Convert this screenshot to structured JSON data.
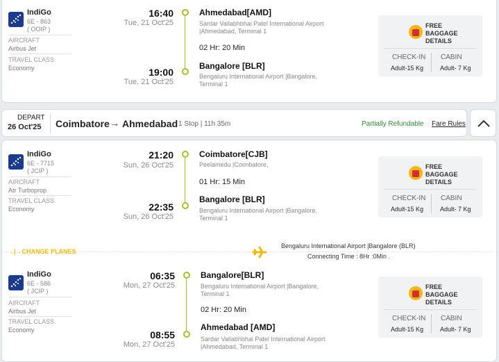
{
  "baggage": {
    "title_line1": "FREE",
    "title_line2": "BAGGAGE",
    "title_line3": "DETAILS",
    "checkin_label": "CHECK-IN",
    "cabin_label": "CABIN",
    "checkin_value": "Adult-15 Kg",
    "cabin_value": "Adult- 7 Kg"
  },
  "labels": {
    "aircraft": "AIRCRAFT",
    "travel_class": "TRAVEL CLASS"
  },
  "flight1": {
    "airline": "IndiGo",
    "flight_no": "6E - 863",
    "code": "( OOIP )",
    "aircraft": "Airbus Jet",
    "class": "Economy",
    "dep_time": "16:40",
    "dep_date": "Tue, 21 Oct'25",
    "dep_city": "Ahmedabad[AMD]",
    "dep_airport1": "Sardar Vallabhbhai Patel International Airport",
    "dep_airport2": "|Ahmedabad, Terminal 1",
    "duration": "02 Hr: 20 Min",
    "arr_time": "19:00",
    "arr_date": "Tue, 21 Oct'25",
    "arr_city": "Bangalore [BLR]",
    "arr_airport1": "Bengaluru International Airport |Bangalore,",
    "arr_airport2": "Terminal 1"
  },
  "header2": {
    "depart_label": "DEPART",
    "depart_date": "26 Oct'25",
    "from": "Coimbatore",
    "to": "Ahmedabad",
    "stops": "1 Stop | 11h 35m",
    "refund": "Partially Refundable",
    "fare_rules": "Fare Rules"
  },
  "flight2": {
    "airline": "IndiGo",
    "flight_no": "6E - 7715",
    "code": "( JCIP )",
    "aircraft": "Atr Turboprop",
    "class": "Economy",
    "dep_time": "21:20",
    "dep_date": "Sun, 26 Oct'25",
    "dep_city": "Coimbatore[CJB]",
    "dep_airport1": "Peelamedu |Coimbatore,",
    "dep_airport2": "",
    "duration": "01 Hr: 15 Min",
    "arr_time": "22:35",
    "arr_date": "Sun, 26 Oct'25",
    "arr_city": "Bangalore [BLR]",
    "arr_airport1": "Bengaluru International Airport |Bangalore,",
    "arr_airport2": "Terminal 1"
  },
  "change": {
    "label": "→|→CHANGE PLANES",
    "airport": "Bengaluru International Airport |Bangalore (BLR)",
    "connecting": "Connecting Time : 8Hr :0Min ."
  },
  "flight3": {
    "airline": "IndiGo",
    "flight_no": "6E - 586",
    "code": "( JCIP )",
    "aircraft": "Airbus Jet",
    "class": "Economy",
    "dep_time": "06:35",
    "dep_date": "Mon, 27 Oct'25",
    "dep_city": "Bangalore[BLR]",
    "dep_airport1": "Bengaluru International Airport |Bangalore,",
    "dep_airport2": "Terminal 1",
    "duration": "02 Hr: 20 Min",
    "arr_time": "08:55",
    "arr_date": "Mon, 27 Oct'25",
    "arr_city": "Ahmedabad [AMD]",
    "arr_airport1": "Sardar Vallabhbhai Patel International Airport",
    "arr_airport2": "|Ahmedabad, Terminal 1"
  }
}
